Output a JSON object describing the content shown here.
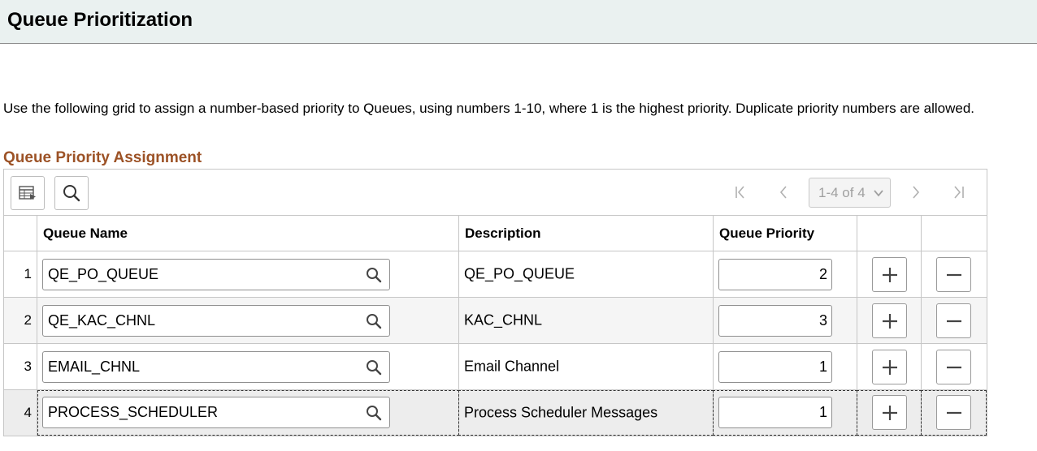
{
  "page": {
    "title": "Queue Prioritization",
    "instructions": "Use the following grid to assign a number-based priority to Queues, using numbers 1-10, where 1 is the highest priority. Duplicate priority numbers are allowed.",
    "section_title": "Queue Priority Assignment"
  },
  "toolbar": {
    "personalize_icon": "grid-personalize-icon",
    "find_icon": "search-icon",
    "pager_label": "1-4 of 4",
    "nav_icons": [
      "first-page-icon",
      "previous-page-icon",
      "next-page-icon",
      "last-page-icon"
    ]
  },
  "columns": {
    "queue_name": "Queue Name",
    "description": "Description",
    "queue_priority": "Queue Priority"
  },
  "rows": [
    {
      "num": "1",
      "queue": "QE_PO_QUEUE",
      "description": "QE_PO_QUEUE",
      "priority": "2"
    },
    {
      "num": "2",
      "queue": "QE_KAC_CHNL",
      "description": "KAC_CHNL",
      "priority": "3"
    },
    {
      "num": "3",
      "queue": "EMAIL_CHNL",
      "description": "Email Channel",
      "priority": "1"
    },
    {
      "num": "4",
      "queue": "PROCESS_SCHEDULER",
      "description": "Process Scheduler Messages",
      "priority": "1"
    }
  ]
}
